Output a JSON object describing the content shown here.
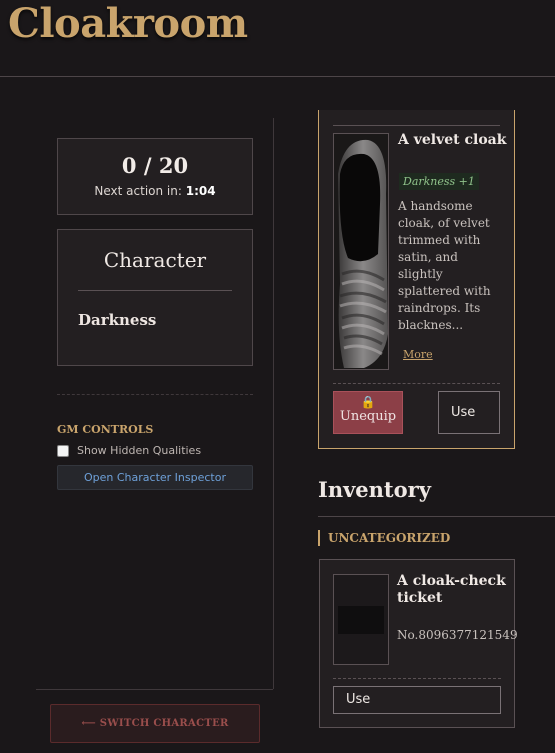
{
  "page": {
    "title": "Cloakroom"
  },
  "actions": {
    "count": "0 / 20",
    "next_label": "Next action in:",
    "next_time": "1:04"
  },
  "character": {
    "heading": "Character",
    "name": "Darkness"
  },
  "gm": {
    "label": "GM CONTROLS",
    "show_hidden": "Show Hidden Qualities",
    "inspector": "Open Character Inspector"
  },
  "switch": {
    "label": "⟵ SWITCH CHARACTER"
  },
  "equipped": {
    "name": "A velvet cloak",
    "quality": "Darkness +1",
    "description": "A handsome cloak, of velvet trimmed with satin, and slightly splattered with raindrops. Its blacknes...",
    "more": "More",
    "unequip": "Unequip",
    "use": "Use"
  },
  "inventory": {
    "title": "Inventory",
    "category": "UNCATEGORIZED",
    "items": [
      {
        "name": "A cloak-check ticket",
        "detail": "No.8096377121549",
        "use": "Use"
      }
    ]
  },
  "colors": {
    "accent": "#c9a46c",
    "danger": "#8c3f47",
    "link": "#6ea0d8",
    "bg": "#1a1719"
  }
}
